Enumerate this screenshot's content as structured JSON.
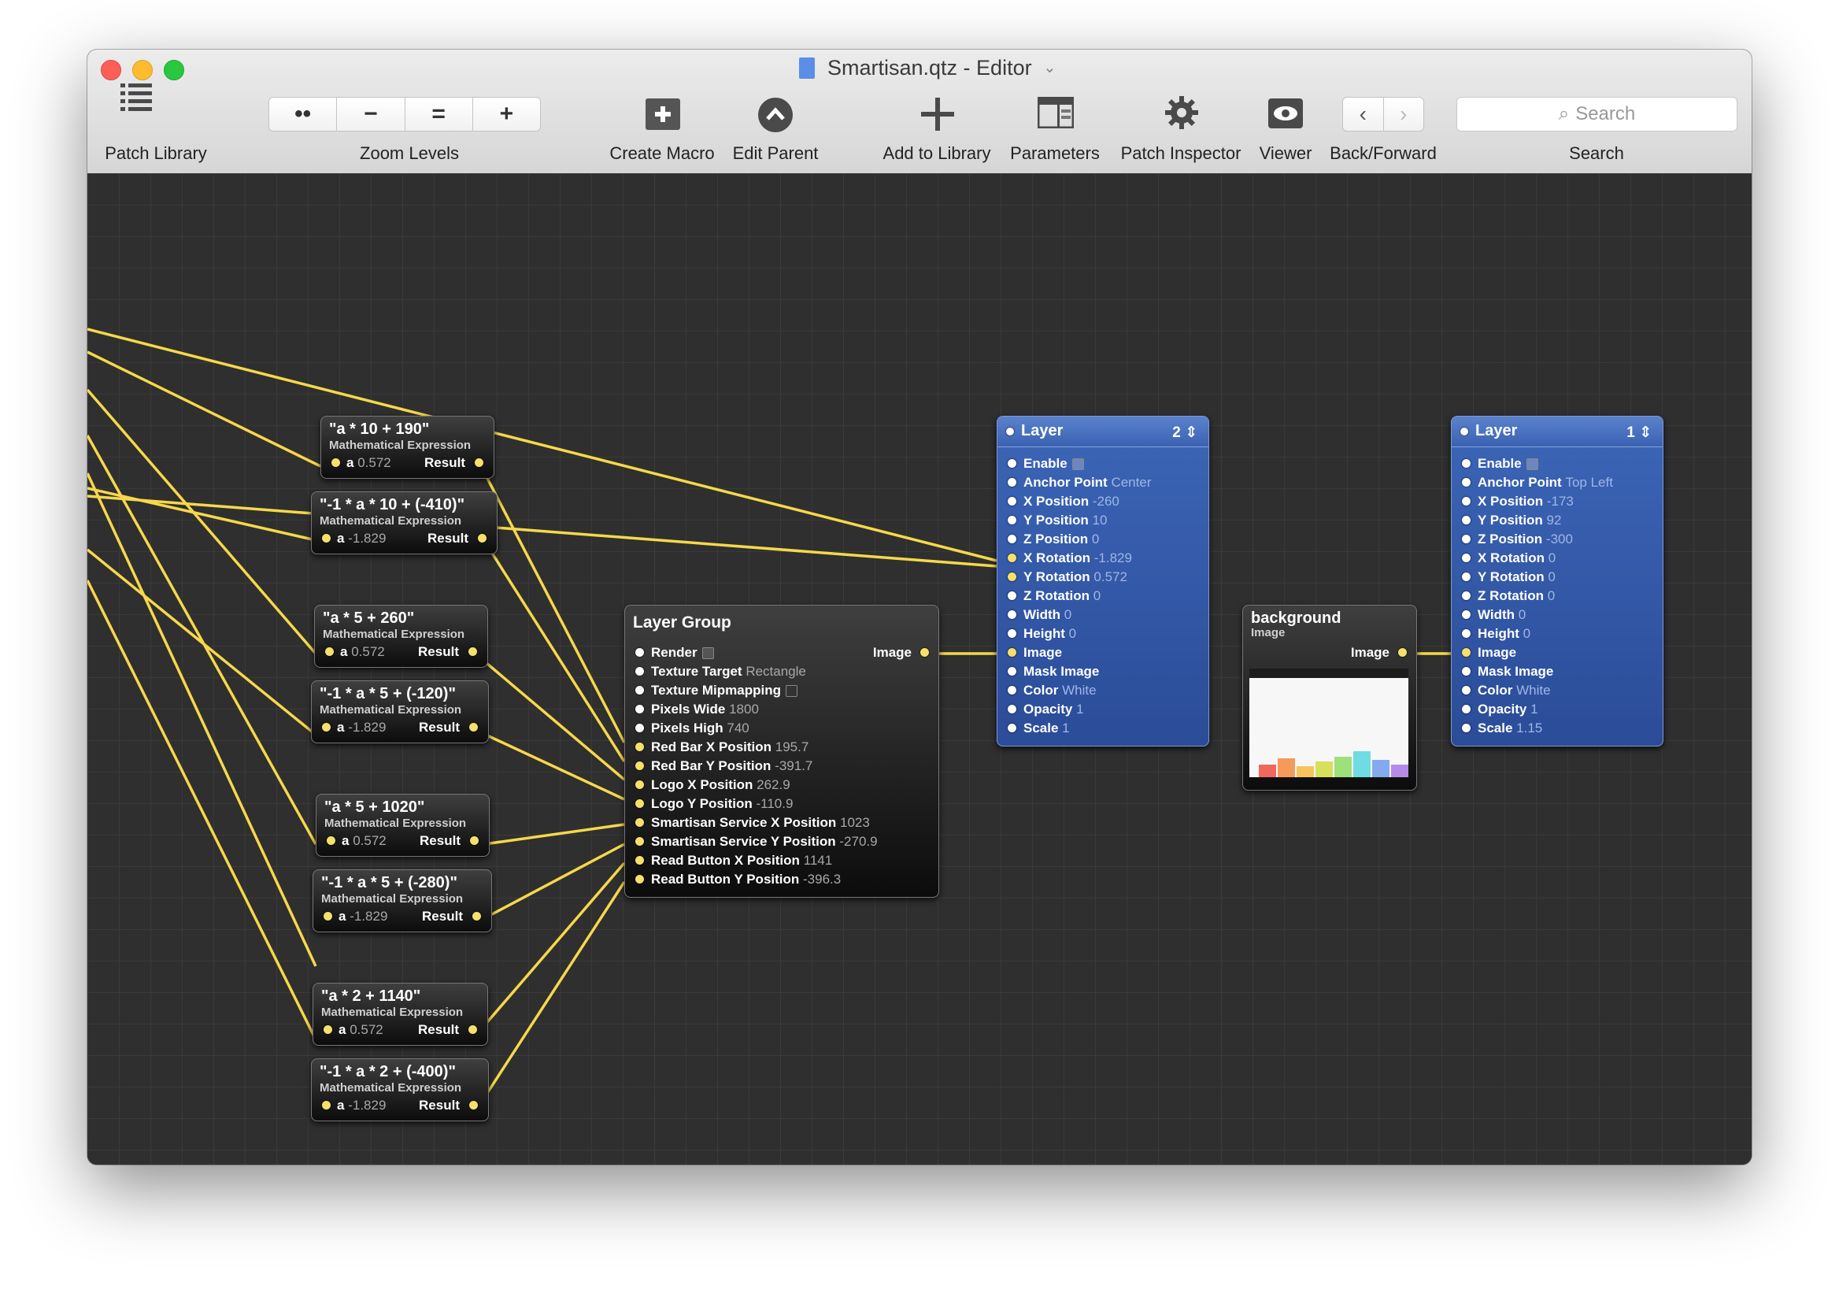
{
  "window": {
    "title": "Smartisan.qtz - Editor",
    "title_chevron": "⌄"
  },
  "toolbar": {
    "patch_library": "Patch Library",
    "zoom_levels": "Zoom Levels",
    "zoom_buttons": [
      "••",
      "−",
      "=",
      "+"
    ],
    "create_macro": "Create Macro",
    "edit_parent": "Edit Parent",
    "add_to_library": "Add to Library",
    "parameters": "Parameters",
    "patch_inspector": "Patch Inspector",
    "viewer": "Viewer",
    "back_forward": "Back/Forward",
    "search_label": "Search",
    "search_placeholder": "Search",
    "back_glyph": "‹",
    "forward_glyph": "›"
  },
  "math_patches": [
    {
      "title": "\"a * 10 + 190\"",
      "subtitle": "Mathematical Expression",
      "input_label": "a",
      "input_value": "0.572",
      "output_label": "Result"
    },
    {
      "title": "\"-1 * a * 10 + (-410)\"",
      "subtitle": "Mathematical Expression",
      "input_label": "a",
      "input_value": "-1.829",
      "output_label": "Result"
    },
    {
      "title": "\"a * 5 + 260\"",
      "subtitle": "Mathematical Expression",
      "input_label": "a",
      "input_value": "0.572",
      "output_label": "Result"
    },
    {
      "title": "\"-1 * a * 5 + (-120)\"",
      "subtitle": "Mathematical Expression",
      "input_label": "a",
      "input_value": "-1.829",
      "output_label": "Result"
    },
    {
      "title": "\"a * 5 + 1020\"",
      "subtitle": "Mathematical Expression",
      "input_label": "a",
      "input_value": "0.572",
      "output_label": "Result"
    },
    {
      "title": "\"-1 * a * 5 + (-280)\"",
      "subtitle": "Mathematical Expression",
      "input_label": "a",
      "input_value": "-1.829",
      "output_label": "Result"
    },
    {
      "title": "\"a * 2 + 1140\"",
      "subtitle": "Mathematical Expression",
      "input_label": "a",
      "input_value": "0.572",
      "output_label": "Result"
    },
    {
      "title": "\"-1 * a * 2 + (-400)\"",
      "subtitle": "Mathematical Expression",
      "input_label": "a",
      "input_value": "-1.829",
      "output_label": "Result"
    }
  ],
  "layer_group": {
    "title": "Layer Group",
    "output_label": "Image",
    "inputs": [
      {
        "label": "Render",
        "value": "",
        "checkbox": true
      },
      {
        "label": "Texture Target",
        "value": "Rectangle"
      },
      {
        "label": "Texture Mipmapping",
        "value": "",
        "checkbox_off": true
      },
      {
        "label": "Pixels Wide",
        "value": "1800"
      },
      {
        "label": "Pixels High",
        "value": "740"
      },
      {
        "label": "Red Bar X Position",
        "value": "195.7"
      },
      {
        "label": "Red Bar Y Position",
        "value": "-391.7"
      },
      {
        "label": "Logo X Position",
        "value": "262.9"
      },
      {
        "label": "Logo Y Position",
        "value": "-110.9"
      },
      {
        "label": "Smartisan Service X Position",
        "value": "1023"
      },
      {
        "label": "Smartisan Service Y Position",
        "value": "-270.9"
      },
      {
        "label": "Read Button X Position",
        "value": "1141"
      },
      {
        "label": "Read Button Y Position",
        "value": "-396.3"
      }
    ]
  },
  "layer_2": {
    "title": "Layer",
    "number": "2",
    "inputs": [
      {
        "label": "Enable",
        "value": "",
        "checkbox": true
      },
      {
        "label": "Anchor Point",
        "value": "Center"
      },
      {
        "label": "X Position",
        "value": "-260"
      },
      {
        "label": "Y Position",
        "value": "10"
      },
      {
        "label": "Z Position",
        "value": "0"
      },
      {
        "label": "X Rotation",
        "value": "-1.829"
      },
      {
        "label": "Y Rotation",
        "value": "0.572"
      },
      {
        "label": "Z Rotation",
        "value": "0"
      },
      {
        "label": "Width",
        "value": "0"
      },
      {
        "label": "Height",
        "value": "0"
      },
      {
        "label": "Image",
        "value": ""
      },
      {
        "label": "Mask Image",
        "value": ""
      },
      {
        "label": "Color",
        "value": "White"
      },
      {
        "label": "Opacity",
        "value": "1"
      },
      {
        "label": "Scale",
        "value": "1"
      }
    ]
  },
  "background_patch": {
    "title": "background",
    "subtitle": "Image",
    "output_label": "Image"
  },
  "layer_1": {
    "title": "Layer",
    "number": "1",
    "inputs": [
      {
        "label": "Enable",
        "value": "",
        "checkbox": true
      },
      {
        "label": "Anchor Point",
        "value": "Top Left"
      },
      {
        "label": "X Position",
        "value": "-173"
      },
      {
        "label": "Y Position",
        "value": "92"
      },
      {
        "label": "Z Position",
        "value": "-300"
      },
      {
        "label": "X Rotation",
        "value": "0"
      },
      {
        "label": "Y Rotation",
        "value": "0"
      },
      {
        "label": "Z Rotation",
        "value": "0"
      },
      {
        "label": "Width",
        "value": "0"
      },
      {
        "label": "Height",
        "value": "0"
      },
      {
        "label": "Image",
        "value": ""
      },
      {
        "label": "Mask Image",
        "value": ""
      },
      {
        "label": "Color",
        "value": "White"
      },
      {
        "label": "Opacity",
        "value": "1"
      },
      {
        "label": "Scale",
        "value": "1.15"
      }
    ]
  },
  "colors": {
    "wire": "#f6d84a",
    "canvas": "#2f2f2f",
    "layer_patch": "#2f56a6",
    "patch": "#1a1a1a"
  },
  "icons": [
    "list-icon",
    "macro-icon",
    "edit-parent-icon",
    "plus-icon",
    "parameters-icon",
    "gear-icon",
    "eye-icon",
    "back-icon",
    "forward-icon",
    "search-icon"
  ]
}
